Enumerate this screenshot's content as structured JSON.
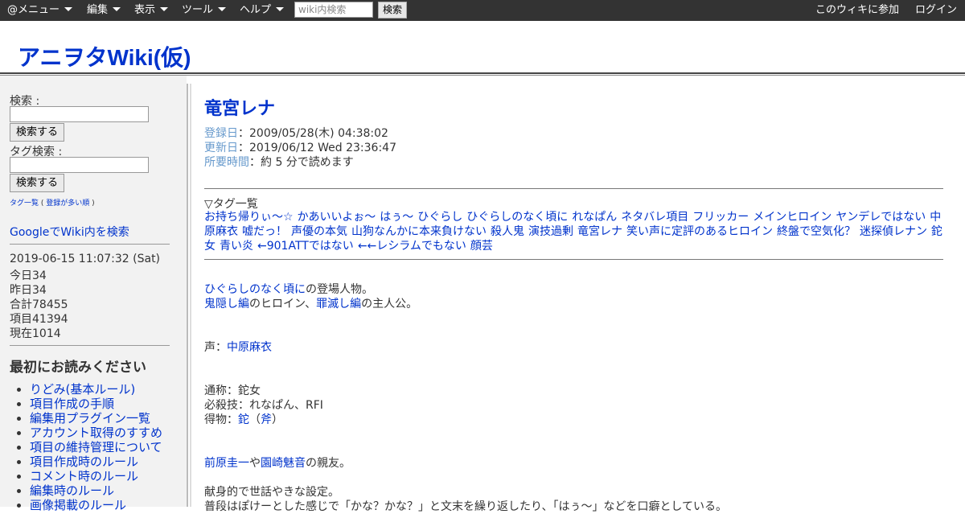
{
  "topbar": {
    "menu": "@メニュー",
    "edit": "編集",
    "view": "表示",
    "tools": "ツール",
    "help": "ヘルプ",
    "search_placeholder": "wiki内検索",
    "search_button": "検索",
    "join": "このウィキに参加",
    "login": "ログイン"
  },
  "site": {
    "title": "アニヲタWiki(仮)"
  },
  "sidebar": {
    "search_label": "検索 :",
    "search_button": "検索する",
    "tag_label": "タグ検索 :",
    "tag_button": "検索する",
    "tag_list_link": "タグ一覧",
    "tag_popular_link": "登録が多い順",
    "google_link": "GoogleでWiki内を検索",
    "datetime": "2019-06-15 11:07:32 (Sat)",
    "today": "今日34",
    "yesterday": "昨日34",
    "total": "合計78455",
    "items": "項目41394",
    "now": "現在1014",
    "read_first_heading": "最初にお読みください",
    "links": [
      "りどみ(基本ルール)",
      "項目作成の手順",
      "編集用プラグイン一覧",
      "アカウント取得のすすめ",
      "項目の維持管理について",
      "項目作成時のルール",
      "コメント時のルール",
      "編集時のルール",
      "画像掲載のルール"
    ]
  },
  "article": {
    "title": "竜宮レナ",
    "registered_label": "登録日",
    "registered": "2009/05/28(木) 04:38:02",
    "updated_label": "更新日",
    "updated": "2019/06/12 Wed 23:36:47",
    "readtime_label": "所要時間",
    "readtime": "約 5 分で読めます",
    "tags_heading": "▽タグ一覧",
    "tags": [
      "お持ち帰りぃ〜☆",
      "かあいいよぉ〜",
      "はぅ〜",
      "ひぐらし",
      "ひぐらしのなく頃に",
      "れなぱん",
      "ネタバレ項目",
      "フリッカー",
      "メインヒロイン",
      "ヤンデレではない",
      "中原麻衣",
      "嘘だっ！",
      "声優の本気",
      "山狗なんかに本来負けない",
      "殺人鬼",
      "演技過剰",
      "竜宮レナ",
      "笑い声に定評のあるヒロイン",
      "終盤で空気化？",
      "迷探偵レナン",
      "鉈女",
      "青い炎",
      "←901ATTではない",
      "←←レシラムでもない",
      "顔芸"
    ],
    "intro_link": "ひぐらしのなく頃に",
    "intro_rest": "の登場人物。",
    "oni_link": "鬼隠し編",
    "oni_rest": "のヒロイン、",
    "tsumi_link": "罪滅し編",
    "tsumi_rest": "の主人公。",
    "voice_label": "声：",
    "voice_link": "中原麻衣",
    "alias": "通称：鉈女",
    "skill": "必殺技：れなぱん、RFI",
    "weapon_label": "得物：",
    "weapon_link1": "鉈",
    "weapon_paren_open": "（",
    "weapon_link2": "斧",
    "weapon_paren_close": "）",
    "friend_link1": "前原圭一",
    "friend_mid": "や",
    "friend_link2": "園崎魅音",
    "friend_rest": "の親友。",
    "personality": "献身的で世話やきな設定。",
    "partial": "普段はぽけーとした感じで「かな？かな？」と文末を繰り返したり、「はぅ～」などを口癖としている。"
  }
}
